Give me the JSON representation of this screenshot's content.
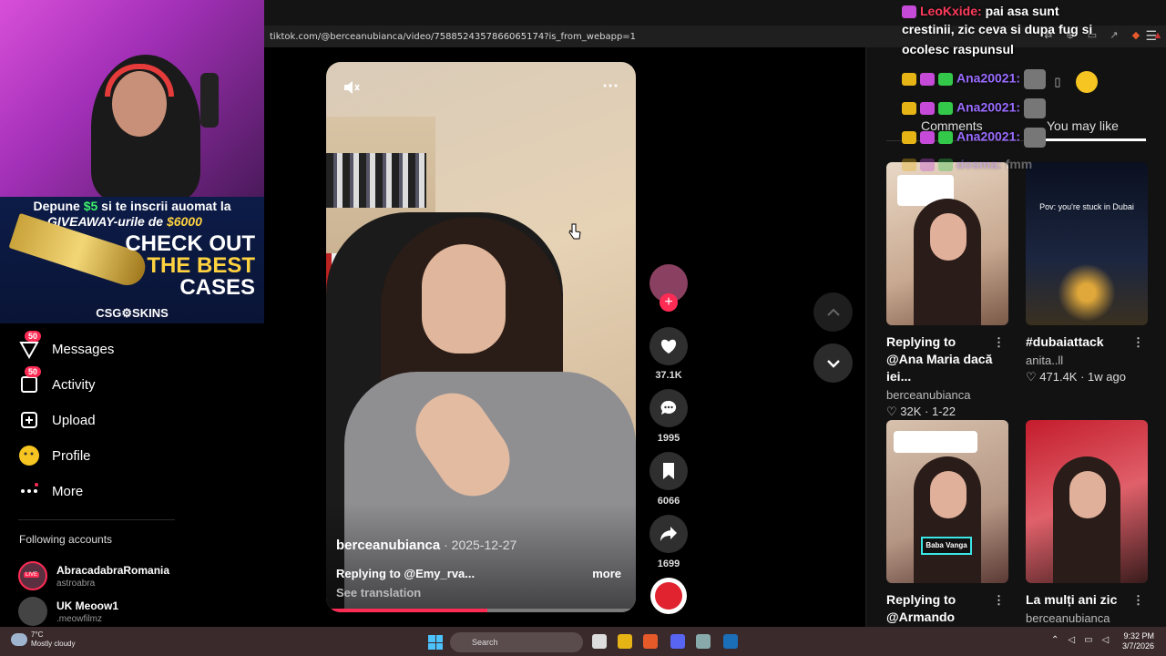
{
  "browser": {
    "url": "tiktok.com/@berceanubianca/video/7588524357866065174?is_from_webapp=1"
  },
  "sidebar": {
    "items": [
      {
        "label": "Messages",
        "badge": "50",
        "icon": "paper-plane-icon"
      },
      {
        "label": "Activity",
        "badge": "50",
        "icon": "inbox-icon"
      },
      {
        "label": "Upload",
        "icon": "plus-square-icon"
      },
      {
        "label": "Profile",
        "icon": "avatar-icon"
      },
      {
        "label": "More",
        "icon": "more-dots-icon"
      }
    ],
    "following_title": "Following accounts",
    "accounts": [
      {
        "name": "AbracadabraRomania",
        "handle": "astroabra",
        "live": "LIVE"
      },
      {
        "name": "UK Meoow1",
        "handle": ".meowfilmz"
      }
    ]
  },
  "overlay": {
    "ad": {
      "line1_pre": "Depune ",
      "line1_amount": "$5",
      "line1_post": " si te inscrii auomat la",
      "line2_pre": "GIVEAWAY-urile de ",
      "line2_amount": "$6000",
      "check": "CHECK OUT",
      "best": "THE BEST",
      "cases": "CASES",
      "brand": "CSG⚙SKINS"
    },
    "chat": [
      {
        "user": "LeoKxide:",
        "text": "pai asa sunt",
        "text2": "crestinii, zic ceva si dupa fug si",
        "text3": "ocolesc raspunsul"
      },
      {
        "user": "Ana20021:"
      },
      {
        "user": "Ana20021:"
      },
      {
        "user": "Ana20021:"
      },
      {
        "user": "dosma:",
        "text": "fmm"
      }
    ]
  },
  "video": {
    "author": "berceanubianca",
    "date": " · 2025-12-27",
    "description": "Replying to @Emy_rva...",
    "more": "more",
    "see_translation": "See translation",
    "progress": 0.52
  },
  "actions": {
    "likes": "37.1K",
    "comments": "1995",
    "saves": "6066",
    "shares": "1699"
  },
  "right_panel": {
    "tabs": [
      "Comments",
      "You may like"
    ],
    "active_tab": "You may like",
    "cards": [
      {
        "title": "Replying to @Ana Maria dacă iei...",
        "author": "berceanubianca",
        "stats": "♡ 32K · 1-22"
      },
      {
        "title": "#dubaiattack",
        "author": "anita..ll",
        "stats": "♡ 471.4K · 1w ago",
        "caption": "Pov: you're stuck in Dubai"
      },
      {
        "title": "Replying to @Armando baba...",
        "author": "",
        "stats": "",
        "banner": "Baba Vanga"
      },
      {
        "title": "La mulți ani zic",
        "author": "berceanubianca",
        "stats": ""
      }
    ]
  },
  "taskbar": {
    "temp": "7°C",
    "weather": "Mostly cloudy",
    "search": "Search",
    "time": "9:32 PM",
    "date": "3/7/2026"
  }
}
